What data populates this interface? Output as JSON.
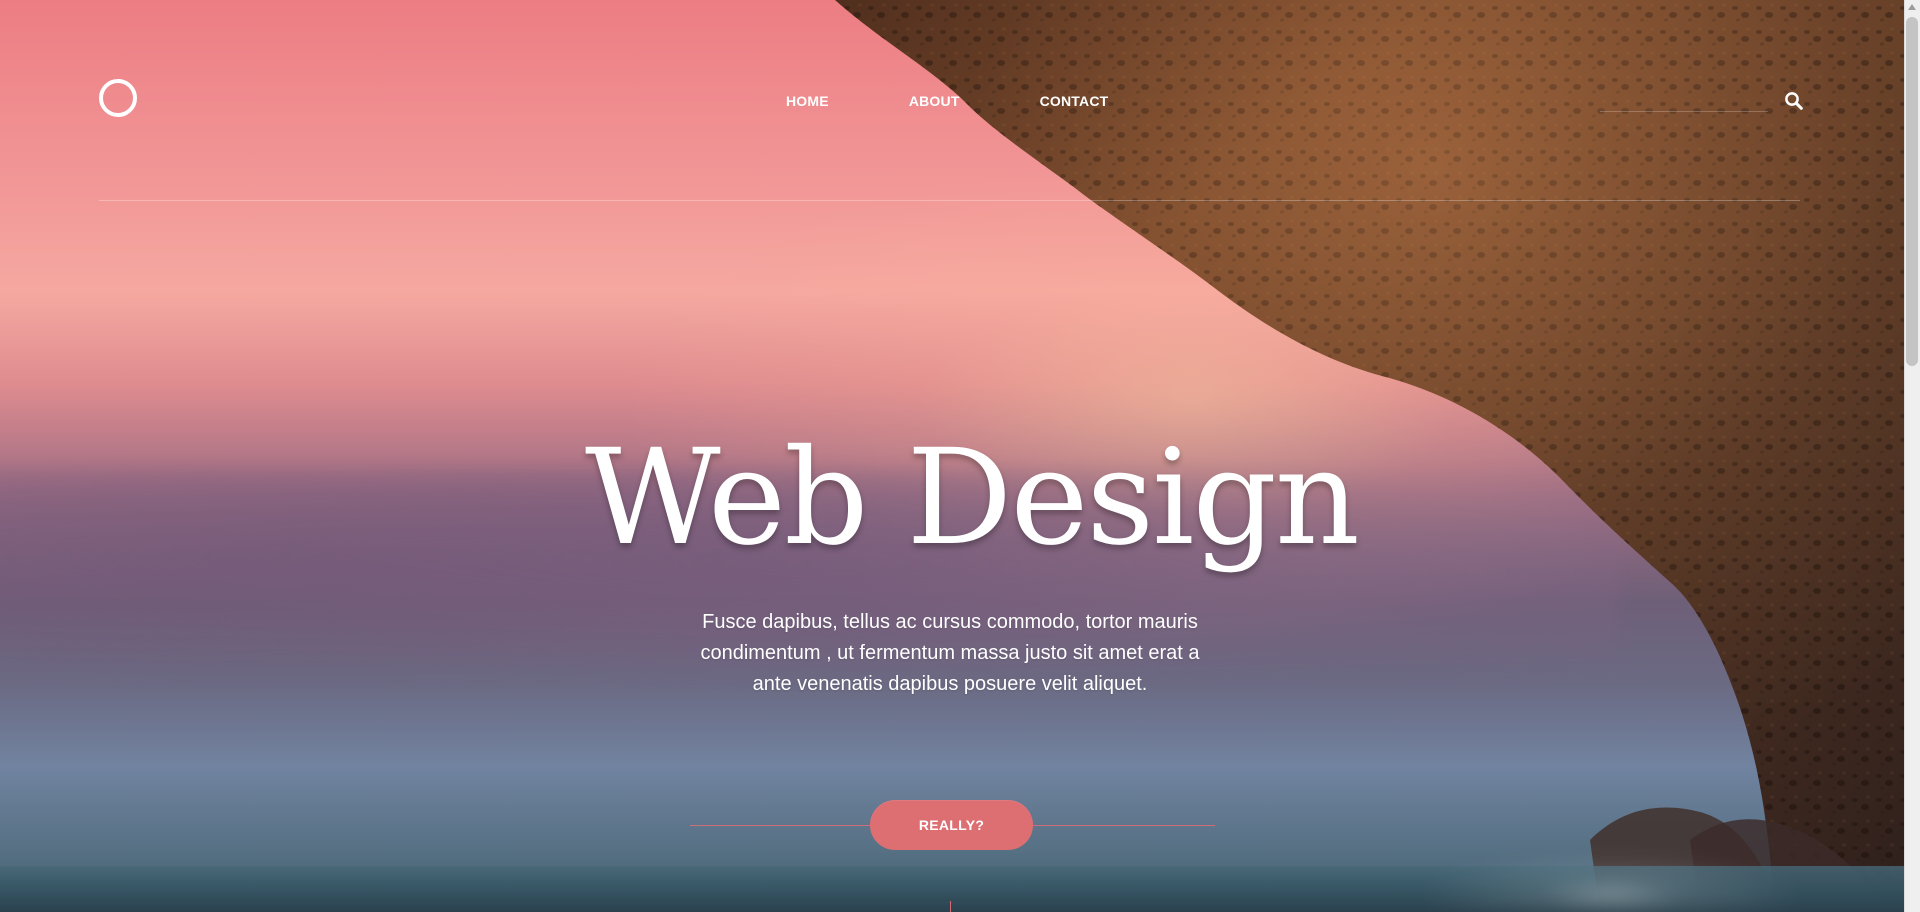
{
  "header": {
    "logo": "circle-logo",
    "nav_items": [
      {
        "label": "HOME"
      },
      {
        "label": "ABOUT"
      },
      {
        "label": "CONTACT"
      }
    ],
    "search": {
      "placeholder": "",
      "icon": "search-icon"
    }
  },
  "hero": {
    "title": "Web Design",
    "copy": "Fusce dapibus, tellus ac cursus commodo, tortor mauris condimentum , ut fermentum massa justo sit amet erat a ante venenatis dapibus posuere velit aliquet.",
    "button_label": "REALLY?"
  },
  "theme": {
    "accent": "#dd6f73",
    "text": "#ffffff"
  },
  "scrollbar": {
    "thumb_fraction": 0.39
  }
}
